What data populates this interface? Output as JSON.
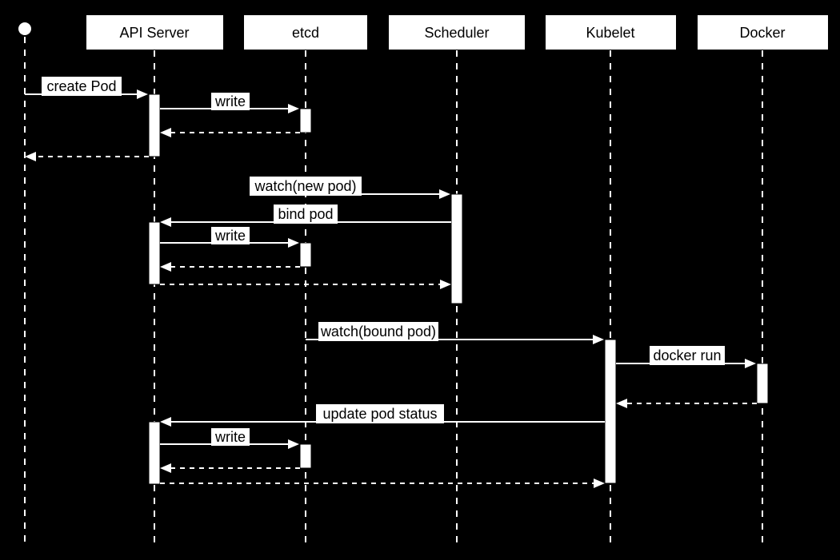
{
  "participants": {
    "api_server": "API Server",
    "etcd": "etcd",
    "scheduler": "Scheduler",
    "kubelet": "Kubelet",
    "docker": "Docker"
  },
  "messages": {
    "create_pod": "create Pod",
    "write1": "write",
    "watch_new": "watch(new pod)",
    "bind_pod": "bind pod",
    "write2": "write",
    "watch_bound": "watch(bound pod)",
    "docker_run": "docker run",
    "update_status": "update pod status",
    "write3": "write"
  }
}
